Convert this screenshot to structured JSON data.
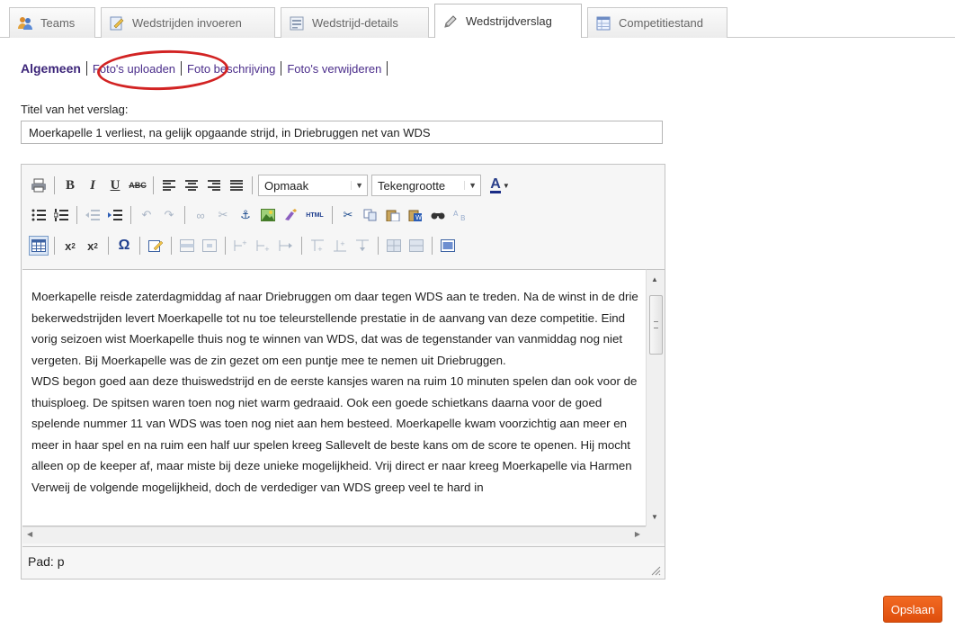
{
  "tabs": [
    {
      "label": "Teams",
      "icon": "people-icon"
    },
    {
      "label": "Wedstrijden invoeren",
      "icon": "edit-form-icon"
    },
    {
      "label": "Wedstrijd-details",
      "icon": "details-icon"
    },
    {
      "label": "Wedstrijdverslag",
      "icon": "pencil-icon",
      "active": true
    },
    {
      "label": "Competitiestand",
      "icon": "table-icon"
    }
  ],
  "subnav": {
    "general": "Algemeen",
    "upload": "Foto's uploaden",
    "description": "Foto beschrijving",
    "delete": "Foto's verwijderen"
  },
  "title_field": {
    "label": "Titel van het verslag:",
    "value": "Moerkapelle 1 verliest, na gelijk opgaande strijd, in Driebruggen net van WDS"
  },
  "editor": {
    "format_select": "Opmaak",
    "fontsize_select": "Tekengrootte",
    "html_label": "HTML",
    "content": "Moerkapelle reisde zaterdagmiddag af naar Driebruggen om daar tegen WDS aan te treden. Na de winst in de drie bekerwedstrijden levert Moerkapelle tot nu toe teleurstellende prestatie in de aanvang van deze competitie. Eind vorig seizoen wist Moerkapelle thuis nog te winnen van WDS, dat was de tegenstander van vanmiddag nog niet vergeten. Bij Moerkapelle was de zin gezet om een puntje mee te nemen uit Driebruggen.\nWDS begon goed aan deze thuiswedstrijd en de eerste kansjes waren na ruim 10 minuten spelen  dan ook voor de thuisploeg. De spitsen waren toen nog niet warm gedraaid. Ook een goede schietkans daarna voor de goed spelende nummer 11 van WDS was toen nog niet aan hem besteed. Moerkapelle kwam voorzichtig aan meer en meer in haar spel en na ruim een half uur spelen kreeg Sallevelt de beste kans om de score te openen. Hij mocht alleen op de keeper af, maar miste bij deze unieke mogelijkheid. Vrij direct er naar kreeg Moerkapelle via Harmen Verweij de volgende mogelijkheid, doch de verdediger van WDS greep veel te hard in",
    "path_label": "Pad: p"
  },
  "save_button": "Opslaan",
  "colors": {
    "link": "#4a2c8a",
    "highlight_circle": "#d22323",
    "save_button": "#ea5b16"
  }
}
